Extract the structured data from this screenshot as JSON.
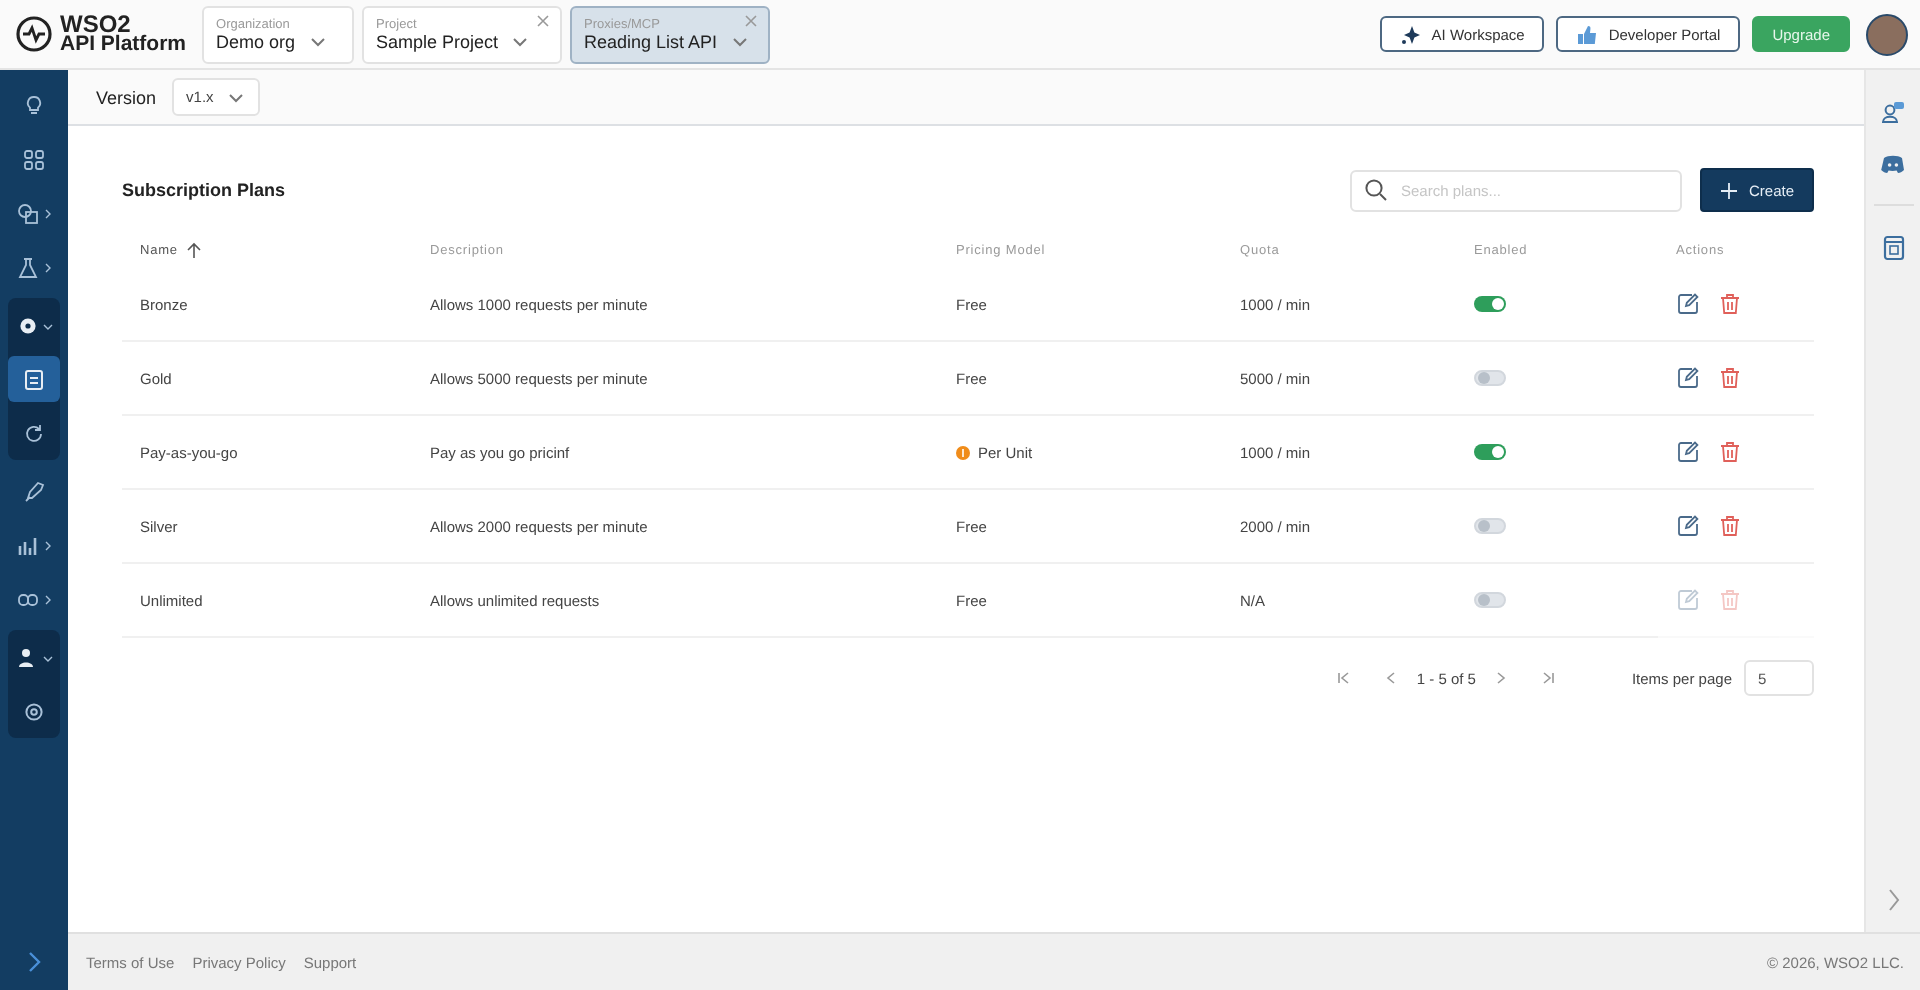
{
  "header": {
    "logo_line1": "WSO2",
    "logo_line2": "API Platform",
    "selectors": [
      {
        "label": "Organization",
        "value": "Demo org",
        "closable": false,
        "selected": false
      },
      {
        "label": "Project",
        "value": "Sample Project",
        "closable": true,
        "selected": false
      },
      {
        "label": "Proxies/MCP",
        "value": "Reading List API",
        "closable": true,
        "selected": true
      }
    ],
    "buttons": [
      {
        "label": "AI Workspace",
        "kind": "ai"
      },
      {
        "label": "Developer Portal",
        "kind": "portal"
      },
      {
        "label": "Upgrade",
        "kind": "primary"
      }
    ]
  },
  "sidebar": {
    "items": [
      {
        "selected": false
      },
      {
        "selected": false
      },
      {
        "selected": false,
        "expanded": false
      },
      {
        "selected": false,
        "expanded": false
      },
      {
        "selected": false,
        "expanded": true,
        "children": [
          {
            "selected": true
          },
          {
            "selected": false
          }
        ]
      },
      {
        "selected": false
      },
      {
        "selected": false,
        "expanded": false
      },
      {
        "selected": false,
        "expanded": false
      },
      {
        "selected": false,
        "expanded": true,
        "children": [
          {
            "selected": false
          }
        ]
      }
    ]
  },
  "version": {
    "label": "Version",
    "value": "v1.x"
  },
  "plans": {
    "title": "Subscription Plans",
    "search": {
      "placeholder": "Search plans..."
    },
    "create_button": "Create",
    "columns": [
      {
        "label": "Name",
        "sorted": true
      },
      {
        "label": "Description",
        "sorted": false
      },
      {
        "label": "Pricing Model",
        "sorted": false
      },
      {
        "label": "Quota",
        "sorted": false
      },
      {
        "label": "Enabled",
        "sorted": false
      },
      {
        "label": "Actions",
        "sorted": false
      }
    ],
    "rows": [
      {
        "name": "Bronze",
        "description": "Allows 1000 requests per minute",
        "pricing": "Free",
        "paid": false,
        "quota": "1000 / min",
        "enabled": true,
        "actions_disabled": false
      },
      {
        "name": "Gold",
        "description": "Allows 5000 requests per minute",
        "pricing": "Free",
        "paid": false,
        "quota": "5000 / min",
        "enabled": false,
        "actions_disabled": false
      },
      {
        "name": "Pay-as-you-go",
        "description": "Pay as you go pricinf",
        "pricing": "Per Unit",
        "paid": true,
        "quota": "1000 / min",
        "enabled": true,
        "actions_disabled": false
      },
      {
        "name": "Silver",
        "description": "Allows 2000 requests per minute",
        "pricing": "Free",
        "paid": false,
        "quota": "2000 / min",
        "enabled": false,
        "actions_disabled": false
      },
      {
        "name": "Unlimited",
        "description": "Allows unlimited requests",
        "pricing": "Free",
        "paid": false,
        "quota": "N/A",
        "enabled": false,
        "actions_disabled": true
      }
    ],
    "pagination": {
      "range": "1 - 5 of 5",
      "per_page_label": "Items per page",
      "per_page": "5"
    }
  },
  "footer": {
    "links": [
      "Terms of Use",
      "Privacy Policy",
      "Support"
    ],
    "copyright": "© 2026, WSO2 LLC."
  }
}
